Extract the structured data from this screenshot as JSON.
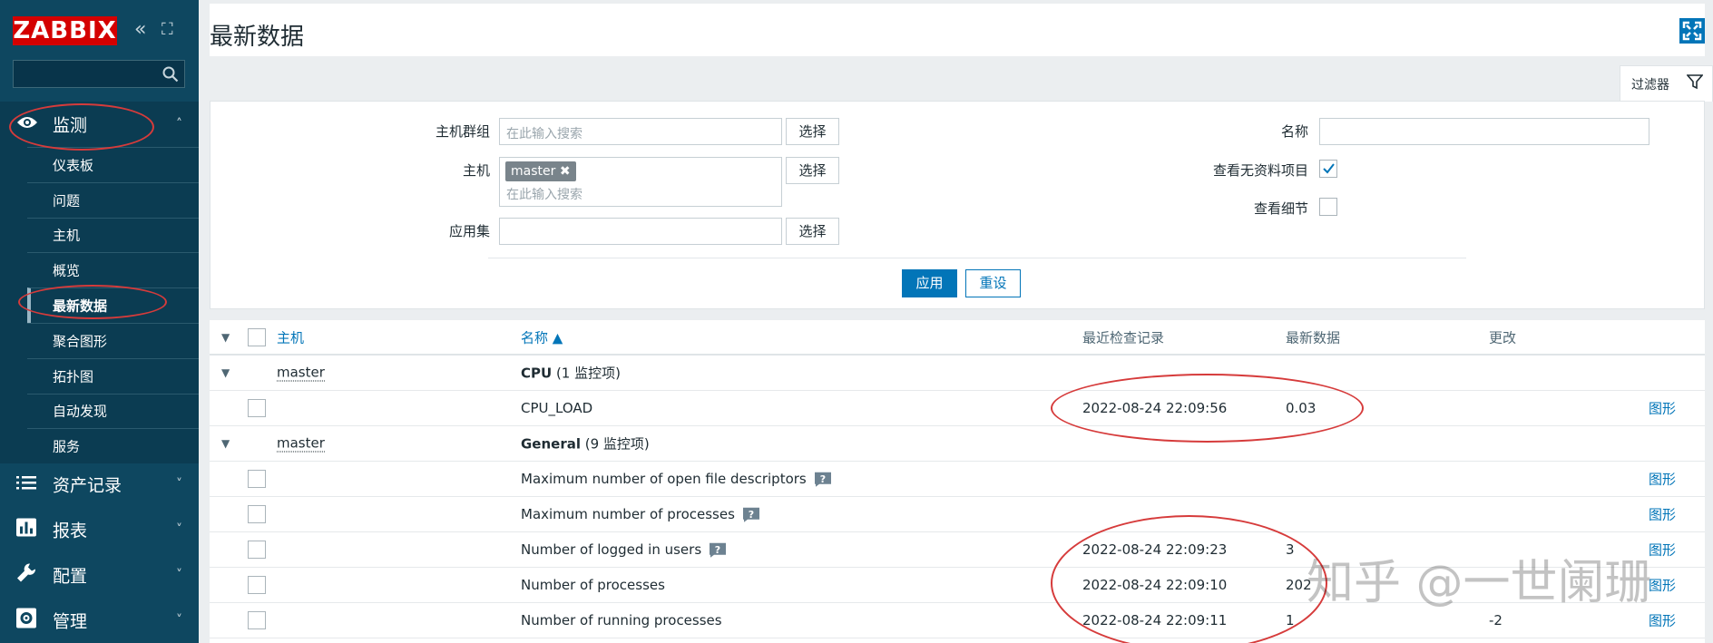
{
  "sidebar": {
    "logo": "ZABBIX",
    "collapse_glyph": "«",
    "kiosk_glyph": "⛶",
    "search_placeholder": "",
    "sections": [
      {
        "label": "监测",
        "icon": "eye-icon",
        "expanded": true
      },
      {
        "label": "资产记录",
        "icon": "list-icon"
      },
      {
        "label": "报表",
        "icon": "bar-chart-icon"
      },
      {
        "label": "配置",
        "icon": "wrench-icon"
      },
      {
        "label": "管理",
        "icon": "gear-icon"
      }
    ],
    "monitoring_items": [
      "仪表板",
      "问题",
      "主机",
      "概览",
      "最新数据",
      "聚合图形",
      "拓扑图",
      "自动发现",
      "服务"
    ],
    "selected_item": "最新数据"
  },
  "header": {
    "title": "最新数据"
  },
  "filter": {
    "tab_label": "过滤器",
    "host_group_label": "主机群组",
    "host_group_placeholder": "在此输入搜索",
    "host_label": "主机",
    "host_tag": "master",
    "host_placeholder": "在此输入搜索",
    "app_label": "应用集",
    "select_label": "选择",
    "name_label": "名称",
    "show_no_data_label": "查看无资料项目",
    "show_no_data_checked": true,
    "show_details_label": "查看细节",
    "show_details_checked": false,
    "apply_label": "应用",
    "reset_label": "重设"
  },
  "table": {
    "headers": {
      "host": "主机",
      "name": "名称 ▲",
      "last_check": "最近检查记录",
      "last_value": "最新数据",
      "change": "更改"
    },
    "groups": [
      {
        "host": "master",
        "app": "CPU",
        "count": " (1 监控项)",
        "items": [
          {
            "name": "CPU_LOAD",
            "last_check": "2022-08-24 22:09:56",
            "last_value": "0.03",
            "change": "",
            "link": "图形",
            "help": false
          }
        ]
      },
      {
        "host": "master",
        "app": "General",
        "count": " (9 监控项)",
        "items": [
          {
            "name": "Maximum number of open file descriptors",
            "last_check": "",
            "last_value": "",
            "change": "",
            "link": "图形",
            "help": true
          },
          {
            "name": "Maximum number of processes",
            "last_check": "",
            "last_value": "",
            "change": "",
            "link": "图形",
            "help": true
          },
          {
            "name": "Number of logged in users",
            "last_check": "2022-08-24 22:09:23",
            "last_value": "3",
            "change": "",
            "link": "图形",
            "help": true
          },
          {
            "name": "Number of processes",
            "last_check": "2022-08-24 22:09:10",
            "last_value": "202",
            "change": "",
            "link": "图形",
            "help": false
          },
          {
            "name": "Number of running processes",
            "last_check": "2022-08-24 22:09:11",
            "last_value": "1",
            "change": "-2",
            "link": "图形",
            "help": false
          }
        ]
      }
    ]
  },
  "watermark": "知乎 @一世阑珊",
  "colors": {
    "sidebar": "#0e4760",
    "accent": "#0275b8",
    "logo": "#d40000",
    "annotation": "#d63b3b"
  }
}
